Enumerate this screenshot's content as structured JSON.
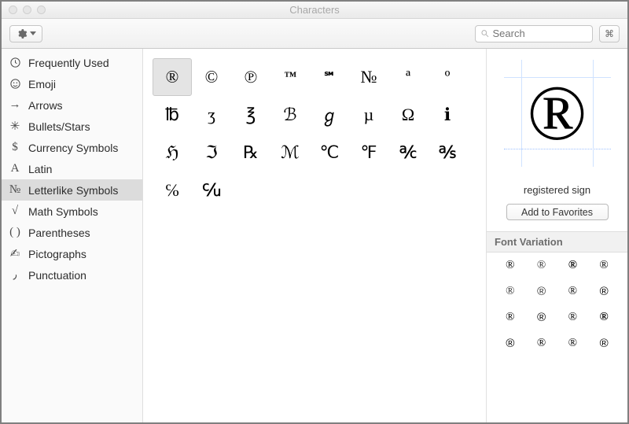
{
  "window": {
    "title": "Characters"
  },
  "toolbar": {
    "search_placeholder": "Search"
  },
  "sidebar": {
    "items": [
      {
        "label": "Frequently Used"
      },
      {
        "label": "Emoji"
      },
      {
        "label": "Arrows"
      },
      {
        "label": "Bullets/Stars"
      },
      {
        "label": "Currency Symbols"
      },
      {
        "label": "Latin"
      },
      {
        "label": "Letterlike Symbols"
      },
      {
        "label": "Math Symbols"
      },
      {
        "label": "Parentheses"
      },
      {
        "label": "Pictographs"
      },
      {
        "label": "Punctuation"
      }
    ],
    "selected_index": 6
  },
  "grid": {
    "rows": [
      [
        "®",
        "©",
        "℗",
        "™",
        "℠",
        "№",
        "ª",
        "º"
      ],
      [
        "℔",
        "ʒ",
        "℥",
        "ℬ",
        "ℊ",
        "µ",
        "Ω",
        "ℹ"
      ],
      [
        "ℌ",
        "ℑ",
        "℞",
        "ℳ",
        "℃",
        "℉",
        "℀",
        "℁"
      ],
      [
        "℅",
        "℆"
      ]
    ],
    "selected": {
      "row": 0,
      "col": 0
    }
  },
  "detail": {
    "glyph": "®",
    "name": "registered sign",
    "add_label": "Add to Favorites",
    "fv_header": "Font Variation",
    "variations": [
      "®",
      "®",
      "®",
      "®",
      "®",
      "®",
      "®",
      "®",
      "®",
      "®",
      "®",
      "®",
      "®",
      "®",
      "®",
      "®"
    ]
  }
}
